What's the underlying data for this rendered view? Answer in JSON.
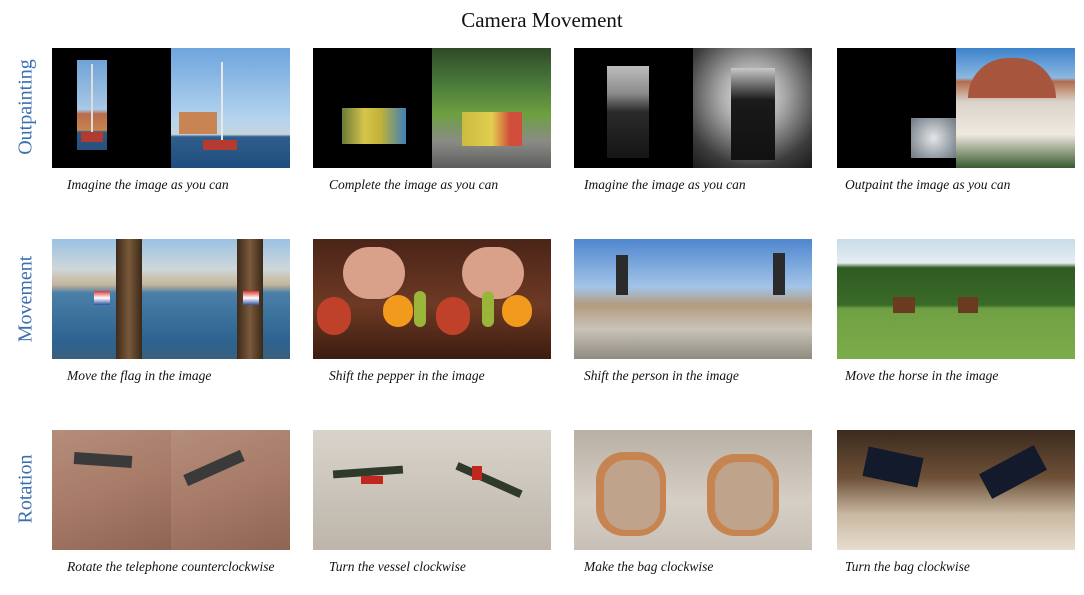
{
  "title": "Camera Movement",
  "rows": [
    {
      "label": "Outpainting",
      "captions": [
        "Imagine the image as you can",
        "Complete the image as you can",
        "Imagine the image as you can",
        "Outpaint the image as you can"
      ]
    },
    {
      "label": "Movement",
      "captions": [
        "Move the flag in the image",
        "Shift the pepper in the image",
        "Shift the person in the image",
        "Move the horse in the image"
      ]
    },
    {
      "label": "Rotation",
      "captions": [
        "Rotate the telephone counterclockwise",
        "Turn the vessel clockwise",
        "Make the bag clockwise",
        "Turn the bag clockwise"
      ]
    }
  ]
}
